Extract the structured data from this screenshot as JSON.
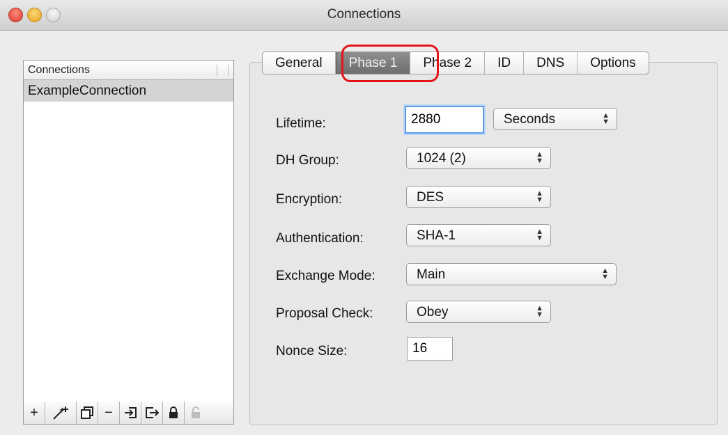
{
  "window": {
    "title": "Connections"
  },
  "list": {
    "header": "Connections",
    "items": [
      "ExampleConnection"
    ]
  },
  "toolbar": [
    {
      "icon": "add-icon",
      "glyph": "+"
    },
    {
      "icon": "magic-wand-add-icon",
      "glyph": "✨"
    },
    {
      "icon": "duplicate-icon",
      "glyph": "⧉"
    },
    {
      "icon": "remove-icon",
      "glyph": "−"
    },
    {
      "icon": "import-icon",
      "glyph": "⇥"
    },
    {
      "icon": "export-icon",
      "glyph": "⇨"
    },
    {
      "icon": "lock-icon",
      "glyph": "🔒"
    },
    {
      "icon": "unlock-icon",
      "glyph": "🔓"
    }
  ],
  "tabs": [
    "General",
    "Phase 1",
    "Phase 2",
    "ID",
    "DNS",
    "Options"
  ],
  "active_tab": "Phase 1",
  "form": {
    "lifetime": {
      "label": "Lifetime:",
      "value": "2880",
      "unit": "Seconds"
    },
    "dh_group": {
      "label": "DH Group:",
      "value": "1024 (2)"
    },
    "encryption": {
      "label": "Encryption:",
      "value": "DES"
    },
    "authentication": {
      "label": "Authentication:",
      "value": "SHA-1"
    },
    "exchange_mode": {
      "label": "Exchange Mode:",
      "value": "Main"
    },
    "proposal_check": {
      "label": "Proposal Check:",
      "value": "Obey"
    },
    "nonce_size": {
      "label": "Nonce Size:",
      "value": "16"
    }
  },
  "colors": {
    "highlight": "#e3141a",
    "focus": "#5b9ae6",
    "active_tab": "#7a7a7a"
  }
}
